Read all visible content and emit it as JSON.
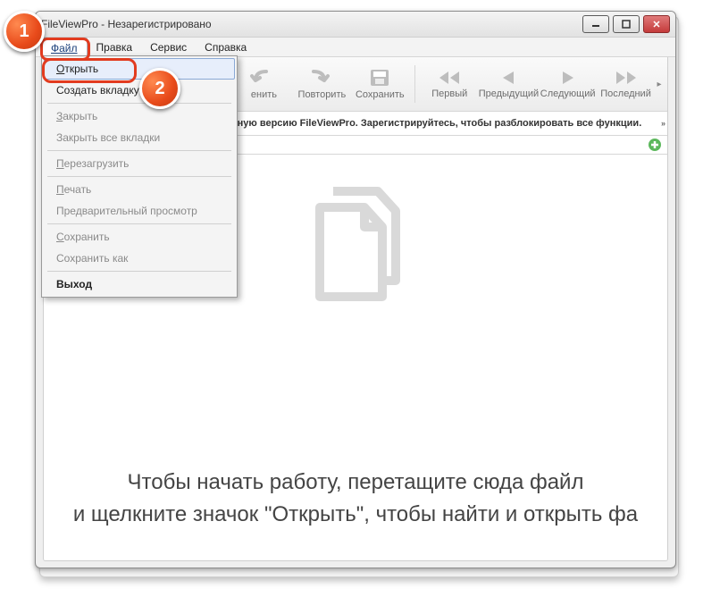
{
  "window": {
    "title": "FileViewPro - Незарегистрировано"
  },
  "menubar": {
    "file": "Файл",
    "edit": "Правка",
    "service": "Сервис",
    "help": "Справка"
  },
  "file_menu": {
    "open": "Открыть",
    "new_tab": "Создать вкладку",
    "close": "Закрыть",
    "close_all": "Закрыть все вкладки",
    "reload": "Перезагрузить",
    "print": "Печать",
    "preview": "Предварительный просмотр",
    "save": "Сохранить",
    "save_as": "Сохранить как",
    "exit": "Выход"
  },
  "toolbar": {
    "undo": "енить",
    "redo": "Повторить",
    "save": "Сохранить",
    "first": "Первый",
    "prev": "Предыдущий",
    "next": "Следующий",
    "last": "Последний"
  },
  "notice": "нную версию FileViewPro. Зарегистрируйтесь, чтобы разблокировать все функции.",
  "dropzone": {
    "line1": "Чтобы начать работу, перетащите сюда файл",
    "line2": "и щелкните значок \"Открыть\", чтобы найти и открыть фа"
  },
  "markers": {
    "m1": "1",
    "m2": "2"
  }
}
